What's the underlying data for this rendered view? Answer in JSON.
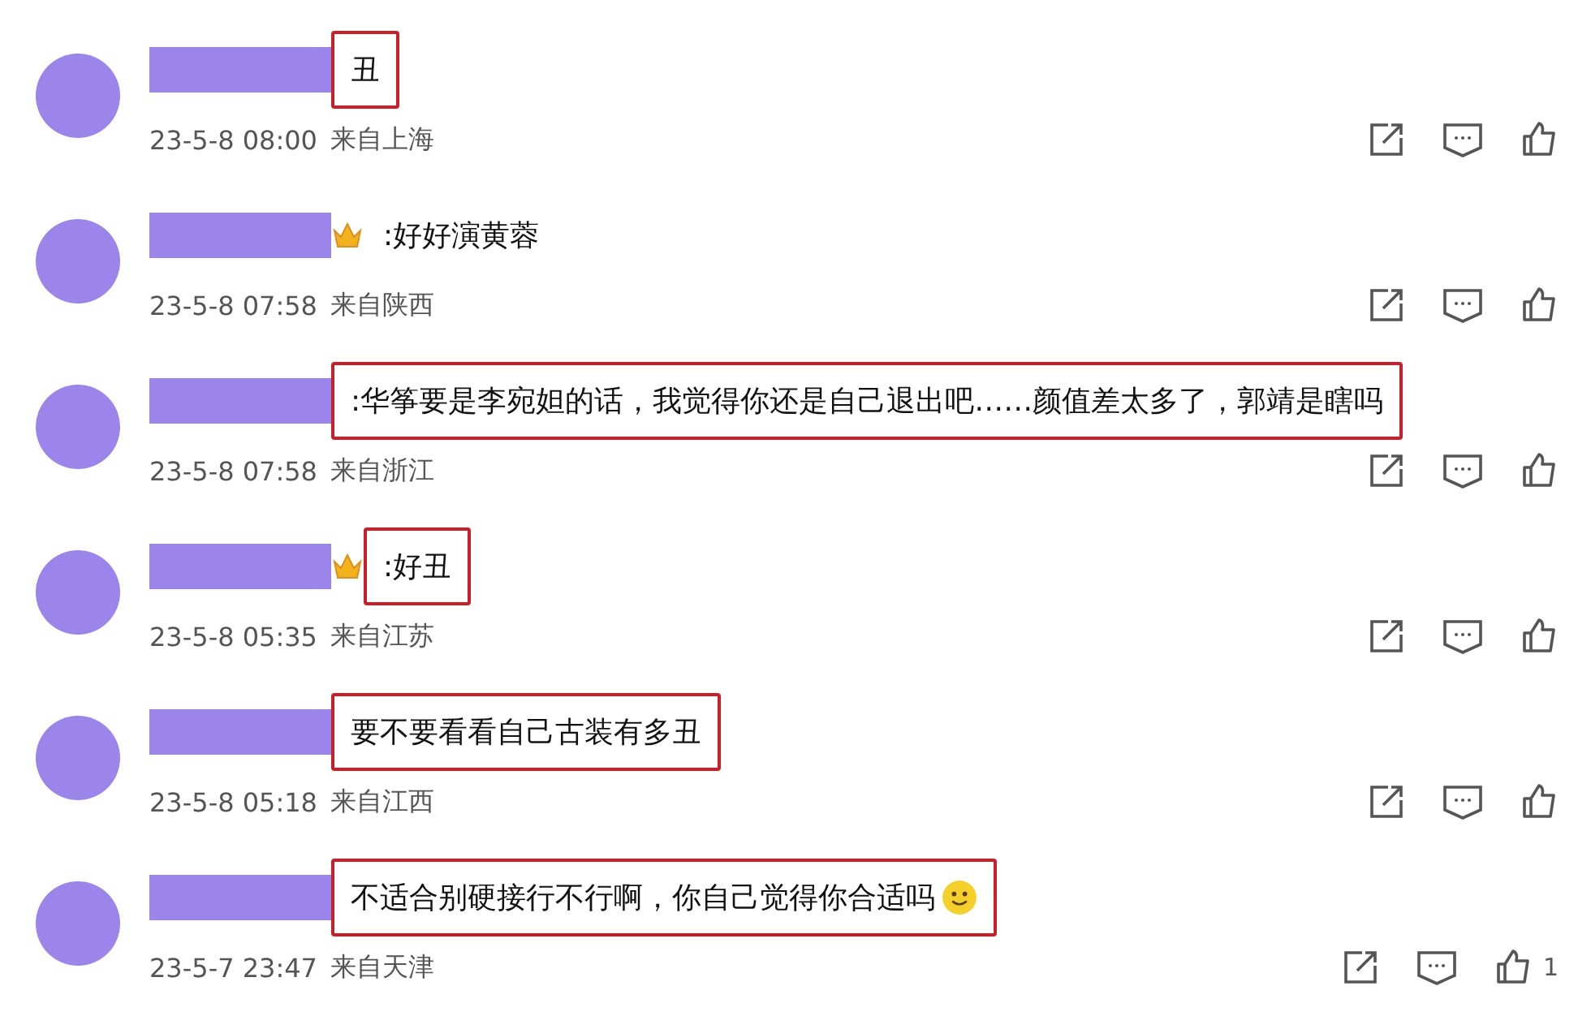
{
  "comments": [
    {
      "text": "丑",
      "badge": false,
      "emoji": false,
      "highlighted": true,
      "time": "23-5-8 08:00",
      "location": "来自上海"
    },
    {
      "text": ":好好演黄蓉",
      "badge": true,
      "emoji": false,
      "highlighted": false,
      "time": "23-5-8 07:58",
      "location": "来自陕西"
    },
    {
      "text": ":华筝要是李宛妲的话，我觉得你还是自己退出吧……颜值差太多了，郭靖是瞎吗",
      "badge": false,
      "emoji": false,
      "highlighted": true,
      "time": "23-5-8 07:58",
      "location": "来自浙江"
    },
    {
      "text": ":好丑",
      "badge": true,
      "emoji": false,
      "highlighted": true,
      "time": "23-5-8 05:35",
      "location": "来自江苏"
    },
    {
      "text": "要不要看看自己古装有多丑",
      "badge": false,
      "emoji": false,
      "highlighted": true,
      "time": "23-5-8 05:18",
      "location": "来自江西"
    },
    {
      "text": "不适合别硬接行不行啊，你自己觉得你合适吗",
      "badge": false,
      "emoji": true,
      "highlighted": true,
      "time": "23-5-7 23:47",
      "location": "来自天津",
      "likes": "1"
    }
  ]
}
